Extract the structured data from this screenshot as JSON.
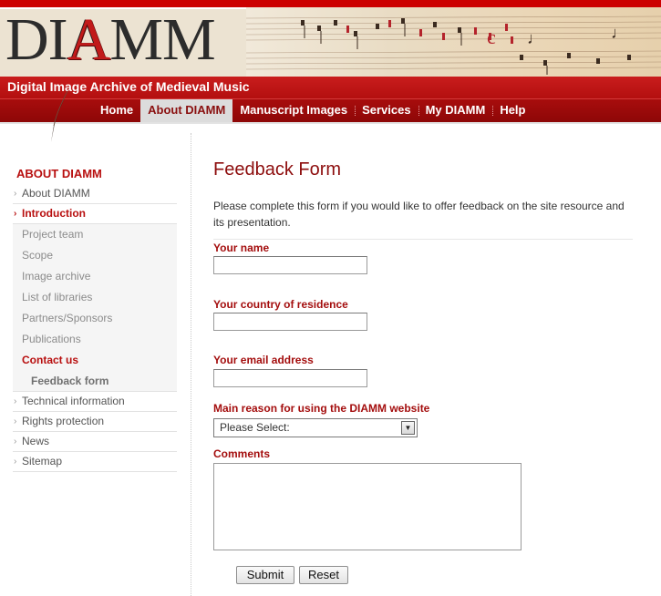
{
  "header": {
    "logo_parts": [
      "DI",
      "A",
      "MM"
    ],
    "tagline": "Digital Image Archive of Medieval Music"
  },
  "nav": {
    "tabs": [
      {
        "label": "Home",
        "active": false
      },
      {
        "label": "About DIAMM",
        "active": true
      },
      {
        "label": "Manuscript Images",
        "active": false
      },
      {
        "label": "Services",
        "active": false
      },
      {
        "label": "My DIAMM",
        "active": false
      },
      {
        "label": "Help",
        "active": false
      }
    ]
  },
  "sidebar": {
    "heading": "ABOUT DIAMM",
    "items": [
      {
        "label": "About DIAMM"
      },
      {
        "label": "Introduction"
      },
      {
        "label": "Project team"
      },
      {
        "label": "Scope"
      },
      {
        "label": "Image archive"
      },
      {
        "label": "List of libraries"
      },
      {
        "label": "Partners/Sponsors"
      },
      {
        "label": "Publications"
      },
      {
        "label": "Contact us"
      },
      {
        "label": "Feedback form"
      },
      {
        "label": "Technical information"
      },
      {
        "label": "Rights protection"
      },
      {
        "label": "News"
      },
      {
        "label": "Sitemap"
      }
    ]
  },
  "main": {
    "title": "Feedback Form",
    "intro": "Please complete this form if you would like to offer feedback on the site resource and its presentation.",
    "fields": {
      "name_label": "Your name",
      "name_value": "",
      "country_label": "Your country of residence",
      "country_value": "",
      "email_label": "Your email address",
      "email_value": "",
      "reason_label": "Main reason for using the DIAMM website",
      "reason_selected": "Please Select:",
      "comments_label": "Comments",
      "comments_value": ""
    },
    "buttons": {
      "submit": "Submit",
      "reset": "Reset"
    }
  },
  "colors": {
    "brand_red": "#b80f0f",
    "nav_red": "#a80d0d",
    "active_tab_bg": "#dcdcdc"
  }
}
